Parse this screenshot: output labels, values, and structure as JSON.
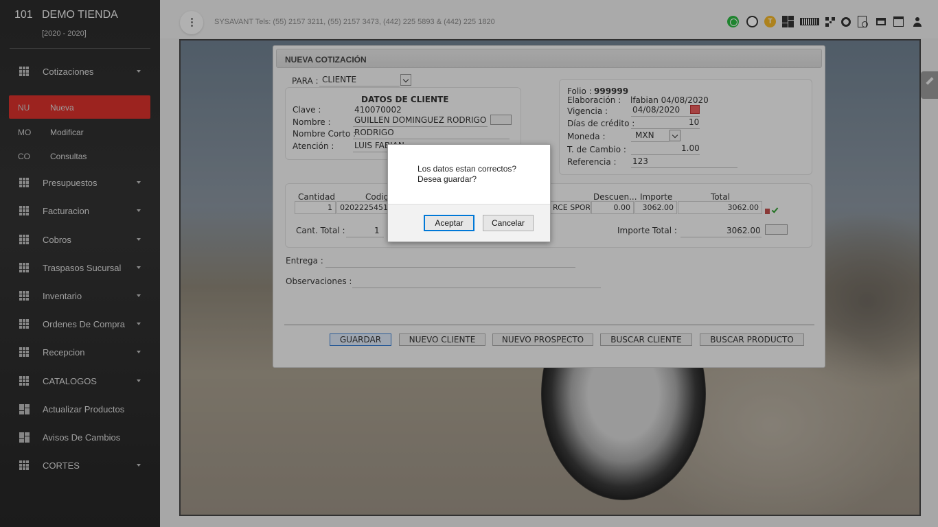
{
  "sidebar": {
    "store_number": "101",
    "store_name": "DEMO TIENDA",
    "period": "[2020 - 2020]",
    "items": [
      {
        "label": "Cotizaciones"
      },
      {
        "label": "Presupuestos"
      },
      {
        "label": "Facturacion"
      },
      {
        "label": "Cobros"
      },
      {
        "label": "Traspasos Sucursal"
      },
      {
        "label": "Inventario"
      },
      {
        "label": "Ordenes De Compra"
      },
      {
        "label": "Recepcion"
      },
      {
        "label": "CATALOGOS"
      },
      {
        "label": "Actualizar Productos"
      },
      {
        "label": "Avisos De Cambios"
      },
      {
        "label": "CORTES"
      }
    ],
    "sub_items": [
      {
        "abbr": "NU",
        "label": "Nueva"
      },
      {
        "abbr": "MO",
        "label": "Modificar"
      },
      {
        "abbr": "CO",
        "label": "Consultas"
      }
    ]
  },
  "topbar": {
    "contact": "SYSAVANT Tels: (55) 2157 3211, (55) 2157 3473, (442) 225 5893 & (442) 225 1820",
    "t_badge": "T"
  },
  "form": {
    "title": "NUEVA COTIZACIÓN",
    "para_label": "PARA :",
    "para_value": "CLIENTE",
    "client_section_title": "DATOS DE CLIENTE",
    "clave_label": "Clave :",
    "clave_value": "410070002",
    "nombre_label": "Nombre :",
    "nombre_value": "GUILLEN DOMINGUEZ RODRIGO",
    "nombre_corto_label": "Nombre Corto :",
    "nombre_corto_value": "RODRIGO",
    "atencion_label": "Atención :",
    "atencion_value": "LUIS FABIAN",
    "folio_label": "Folio :",
    "folio_value": "999999",
    "elaboracion_label": "Elaboración :",
    "elaboracion_value": "lfabian 04/08/2020",
    "vigencia_label": "Vigencia :",
    "vigencia_value": "04/08/2020",
    "dias_label": "Días de crédito :",
    "dias_value": "10",
    "moneda_label": "Moneda :",
    "moneda_value": "MXN",
    "tcambio_label": "T. de Cambio :",
    "tcambio_value": "1.00",
    "referencia_label": "Referencia :",
    "referencia_value": "123",
    "grid_headers": {
      "cantidad": "Cantidad",
      "codigo": "Codig",
      "descuento": "Descuen...",
      "importe": "Importe",
      "total": "Total"
    },
    "row": {
      "cantidad": "1",
      "codigo": "02022254517",
      "descripcion": "RCE SPOR",
      "descuento": "0.00",
      "importe": "3062.00",
      "total": "3062.00"
    },
    "cant_total_label": "Cant. Total :",
    "cant_total_value": "1",
    "importe_total_label": "Importe Total :",
    "importe_total_value": "3062.00",
    "entrega_label": "Entrega :",
    "observaciones_label": "Observaciones :",
    "buttons": {
      "guardar": "GUARDAR",
      "nuevo_cliente": "NUEVO CLIENTE",
      "nuevo_prospecto": "NUEVO PROSPECTO",
      "buscar_cliente": "BUSCAR CLIENTE",
      "buscar_producto": "BUSCAR PRODUCTO"
    }
  },
  "dialog": {
    "line1": "Los datos estan correctos?",
    "line2": "Desea guardar?",
    "accept": "Aceptar",
    "cancel": "Cancelar"
  }
}
